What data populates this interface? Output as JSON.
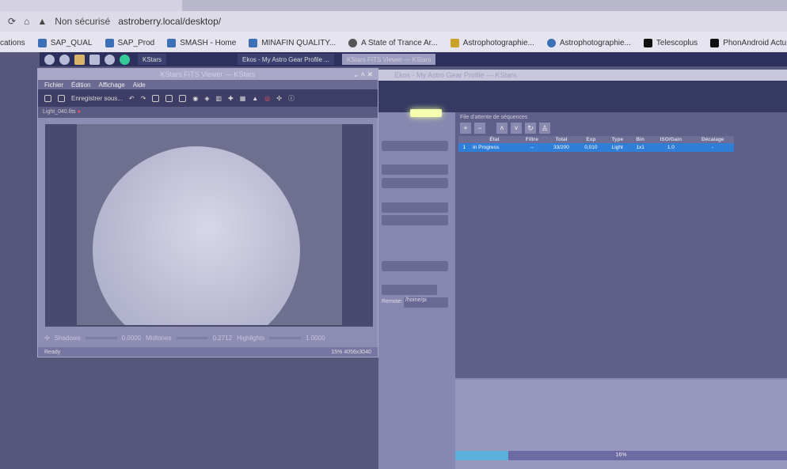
{
  "browser": {
    "security": "Non sécurisé",
    "url": "astroberry.local/desktop/",
    "bookmarks": [
      "cations",
      "SAP_QUAL",
      "SAP_Prod",
      "SMASH - Home",
      "MINAFIN QUALITY...",
      "A State of Trance Ar...",
      "Astrophotographie...",
      "Astrophotographie...",
      "Telescoplus",
      "PhonAndroid Actu..."
    ]
  },
  "taskbar": {
    "tasks": [
      "KStars",
      "Ekos - My Astro Gear Profile ...",
      "KStars FITS Viewer — KStars"
    ]
  },
  "fits": {
    "title": "KStars FITS Viewer — KStars",
    "menu": [
      "Fichier",
      "Édition",
      "Affichage",
      "Aide"
    ],
    "save_as": "Enregistrer sous...",
    "file_tab": "Light_040.fits",
    "shadows_label": "Shadows",
    "shadows": "0.0000",
    "midtones_label": "Midtones",
    "midtones": "0.2712",
    "highlights_label": "Highlights",
    "highlights": "1.0000",
    "status": "Ready",
    "zoom_info": "15% 4056x3040"
  },
  "ekos": {
    "title": "Ekos - My Astro Gear Profile — KStars",
    "remote_label": "Remote:",
    "remote_value": "/home/pi",
    "queue_title": "File d'attente de séquences",
    "columns": [
      "État",
      "Filtre",
      "Total",
      "Exp",
      "Type",
      "Bin",
      "ISO/Gain",
      "Décalage"
    ],
    "rows": [
      {
        "index": "1",
        "etat": "In Progress",
        "filtre": "--",
        "total": "33/200",
        "exp": "0,010",
        "type": "Light",
        "bin": "1x1",
        "iso": "1.0",
        "decalage": "-"
      }
    ],
    "progress_percent": 16,
    "progress_label": "16%"
  },
  "colors": {
    "selection": "#2f7fd8",
    "progress": "#5ab0dc"
  }
}
